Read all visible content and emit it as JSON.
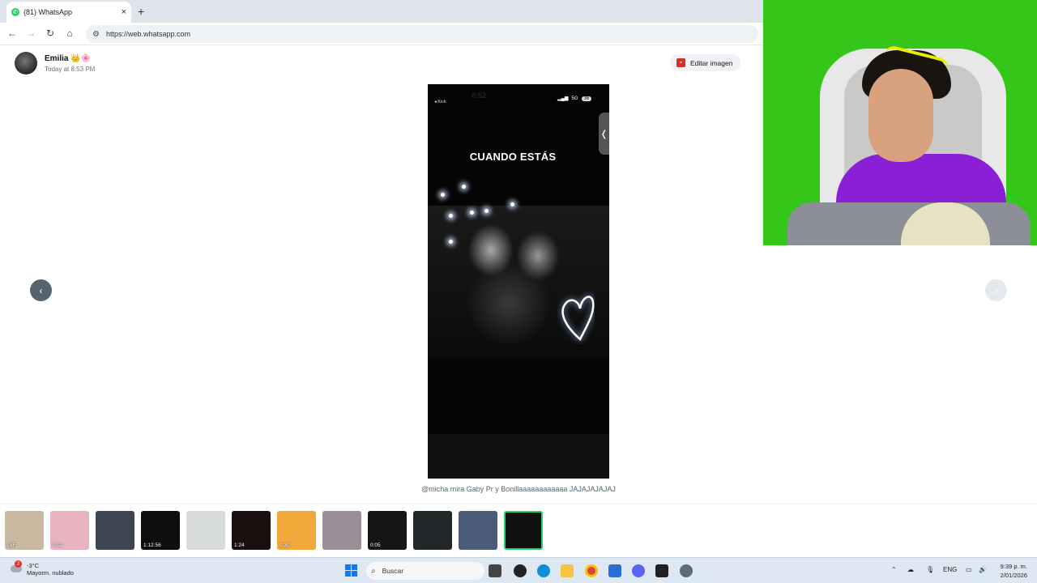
{
  "browser": {
    "tab_title": "(81) WhatsApp",
    "tab_close": "×",
    "new_tab": "+",
    "url": "https://web.whatsapp.com"
  },
  "viewer": {
    "sender_name": "Emilia 👑🌸",
    "timestamp": "Today at 8:53 PM",
    "edit_button": "Editar imagen",
    "caption": "@micha mira Gaby Pr y Bonillaaaaaaaaaaaa JAJAJAJAJAJ",
    "prev_arrow": "‹",
    "next_arrow": "›"
  },
  "media": {
    "status_time": "8:52",
    "status_back": "◂ Kick",
    "status_signal": "5G",
    "status_battery": "36",
    "overlay_text": "CUANDO ESTÁS",
    "side_tab": "❬"
  },
  "thumbnails": [
    {
      "label": "GIF",
      "color": "#c9b9a0"
    },
    {
      "label": "0:02",
      "color": "#e8b4c0"
    },
    {
      "label": "",
      "color": "#3b4652"
    },
    {
      "label": "1:12:56",
      "color": "#0e0e0e"
    },
    {
      "label": "",
      "color": "#d8dcd8"
    },
    {
      "label": "1:24",
      "color": "#1a1010"
    },
    {
      "label": "0:30",
      "color": "#f2a93b"
    },
    {
      "label": "",
      "color": "#9a8f98"
    },
    {
      "label": "0:05",
      "color": "#151515"
    },
    {
      "label": "",
      "color": "#22282a"
    },
    {
      "label": "",
      "color": "#4a5c7a"
    },
    {
      "label": "",
      "color": "#101010"
    }
  ],
  "taskbar": {
    "weather_temp": "-3°C",
    "weather_desc": "Mayorm. nublado",
    "weather_badge": "2",
    "search_placeholder": "Buscar",
    "lang": "ENG",
    "time": "9:39 p. m.",
    "date": "2/01/2026"
  }
}
